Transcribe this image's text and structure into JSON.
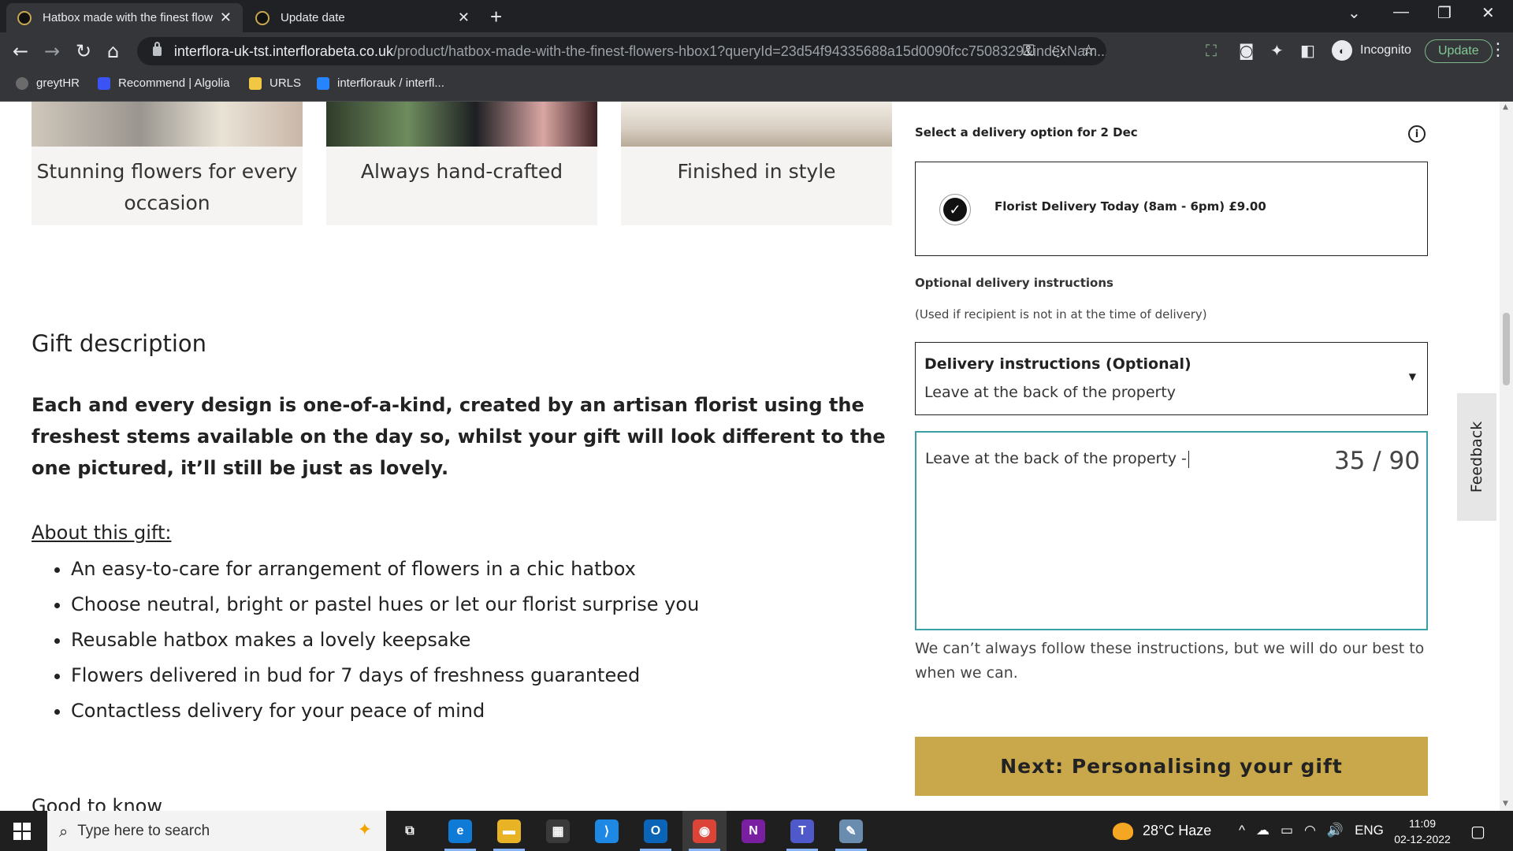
{
  "browser": {
    "tabs": [
      {
        "title": "Hatbox made with the finest flow",
        "close": "✕"
      },
      {
        "title": "Update date",
        "close": "✕"
      }
    ],
    "new_tab": "+",
    "window_controls": {
      "tab_search": "⌄",
      "minimize": "—",
      "restore": "❐",
      "close": "✕"
    },
    "nav": {
      "back": "←",
      "forward": "→",
      "reload": "↻",
      "home": "⌂"
    },
    "url_host": "interflora-uk-tst.interflorabeta.co.uk",
    "url_path": "/product/hatbox-made-with-the-finest-flowers-hbox1?queryId=23d54f94335688a15d0090fcc7508329&indexNam...",
    "omni_icons": {
      "key": "⚿",
      "eye_off": "◌",
      "star": "☆"
    },
    "toolbar_icons": {
      "screenshot": "⛶",
      "camera": "◙",
      "extensions": "✦",
      "sidebar": "◧"
    },
    "incognito_label": "Incognito",
    "update_label": "Update",
    "menu": "⋮",
    "bookmarks": [
      "greytHR",
      "Recommend | Algolia",
      "URLS",
      "interflorauk / interfl..."
    ]
  },
  "page": {
    "image_captions": [
      "Stunning flowers for every occasion",
      "Always hand-crafted",
      "Finished in style"
    ],
    "gift_title": "Gift description",
    "gift_lead": "Each and every design is one-of-a-kind, created by an artisan florist using the freshest stems available on the day so, whilst your gift will look different to the one pictured, it’ll still be just as lovely.",
    "about_title": "About this gift:",
    "about_items": [
      "An easy-to-care for arrangement of flowers in a chic hatbox",
      "Choose neutral, bright or pastel hues or let our florist surprise you",
      "Reusable hatbox makes a lovely keepsake",
      "Flowers delivered in bud for 7 days of freshness guaranteed",
      "Contactless delivery for your peace of mind"
    ],
    "good_to_know": "Good to know"
  },
  "delivery": {
    "option_label": "Select a delivery option for 2 Dec",
    "info_icon": "i",
    "selected_option": "Florist Delivery Today (8am - 6pm) £9.00",
    "check_glyph": "✓",
    "instructions_title": "Optional delivery instructions",
    "instructions_note": "(Used if recipient is not in at the time of delivery)",
    "select_label": "Delivery instructions (Optional)",
    "select_value": "Leave at the back of the property",
    "select_caret": "▼",
    "textarea_value": "Leave at the back of the property -",
    "char_count": "35 / 90",
    "help_text": "We can’t always follow these instructions, but we will do our best to when we can.",
    "next_button": "Next: Personalising your gift"
  },
  "feedback_label": "Feedback",
  "scroll": {
    "up": "▲",
    "down": "▼"
  },
  "taskbar": {
    "search_placeholder": "Type here to search",
    "search_icon": "⌕",
    "search_deco": "✦",
    "apps": [
      {
        "name": "task-view",
        "glyph": "⧉",
        "color": "#1f1f1f"
      },
      {
        "name": "edge",
        "glyph": "e",
        "color": "#0f7bd6"
      },
      {
        "name": "file-explorer",
        "glyph": "▬",
        "color": "#e8b325"
      },
      {
        "name": "microsoft-store",
        "glyph": "▦",
        "color": "#3a3a3a"
      },
      {
        "name": "vscode",
        "glyph": "⟩",
        "color": "#1e88e5"
      },
      {
        "name": "outlook",
        "glyph": "O",
        "color": "#0a64b8"
      },
      {
        "name": "chrome",
        "glyph": "◉",
        "color": "#db4437"
      },
      {
        "name": "onenote",
        "glyph": "N",
        "color": "#7a1fa2"
      },
      {
        "name": "teams",
        "glyph": "T",
        "color": "#5059c9"
      },
      {
        "name": "paint",
        "glyph": "✎",
        "color": "#6a8caf"
      }
    ],
    "weather": "28°C Haze",
    "tray": [
      "^",
      "☁",
      "▭",
      "◠",
      "🔊",
      "ENG"
    ],
    "time": "11:09",
    "date": "02-12-2022",
    "notifications": "▢"
  }
}
